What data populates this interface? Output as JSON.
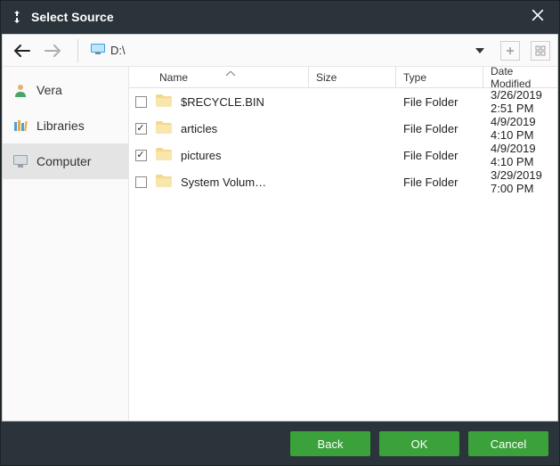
{
  "title": "Select Source",
  "path": "D:\\",
  "sidebar": {
    "items": [
      {
        "label": "Vera"
      },
      {
        "label": "Libraries"
      },
      {
        "label": "Computer"
      }
    ],
    "selected": 2
  },
  "columns": {
    "name": "Name",
    "size": "Size",
    "type": "Type",
    "date": "Date Modified"
  },
  "rows": [
    {
      "checked": false,
      "name": "$RECYCLE.BIN",
      "size": "",
      "type": "File Folder",
      "date": "3/26/2019 2:51 PM"
    },
    {
      "checked": true,
      "name": "articles",
      "size": "",
      "type": "File Folder",
      "date": "4/9/2019 4:10 PM"
    },
    {
      "checked": true,
      "name": "pictures",
      "size": "",
      "type": "File Folder",
      "date": "4/9/2019 4:10 PM"
    },
    {
      "checked": false,
      "name": "System Volum…",
      "size": "",
      "type": "File Folder",
      "date": "3/29/2019 7:00 PM"
    }
  ],
  "footer": {
    "back": "Back",
    "ok": "OK",
    "cancel": "Cancel"
  }
}
